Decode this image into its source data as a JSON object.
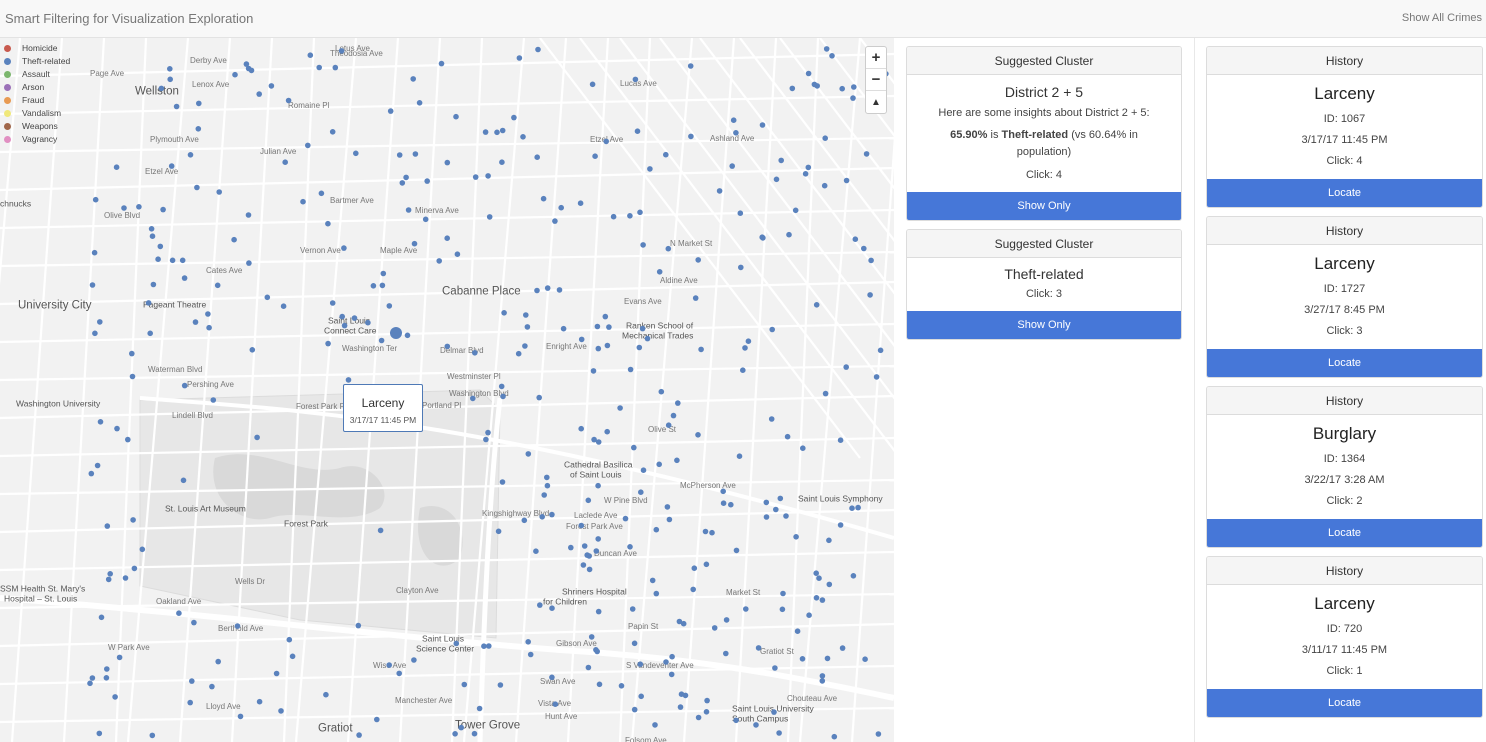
{
  "header": {
    "title": "Smart Filtering for Visualization Exploration",
    "show_all": "Show All Crimes"
  },
  "legend": [
    {
      "label": "Homicide",
      "color": "#c85a4e"
    },
    {
      "label": "Theft-related",
      "color": "#5a82bd"
    },
    {
      "label": "Assault",
      "color": "#7cb66e"
    },
    {
      "label": "Arson",
      "color": "#9b70b8"
    },
    {
      "label": "Fraud",
      "color": "#e89a52"
    },
    {
      "label": "Vandalism",
      "color": "#f0e87a"
    },
    {
      "label": "Weapons",
      "color": "#a0664a"
    },
    {
      "label": "Vagrancy",
      "color": "#e18fc2"
    }
  ],
  "zoom": {
    "in": "+",
    "out": "−",
    "reset": "▲"
  },
  "tooltip": {
    "title": "Larceny",
    "time": "3/17/17 11:45 PM"
  },
  "map_labels": {
    "neighborhoods": [
      {
        "text": "Wellston"
      },
      {
        "text": "University City"
      },
      {
        "text": "Cabanne Place"
      },
      {
        "text": "Gratiot"
      },
      {
        "text": "Tower Grove"
      }
    ],
    "streets": [
      {
        "text": "Derby Ave"
      },
      {
        "text": "Lotus Ave"
      },
      {
        "text": "Page Ave"
      },
      {
        "text": "Lenox Ave"
      },
      {
        "text": "Plymouth Ave"
      },
      {
        "text": "Etzel Ave"
      },
      {
        "text": "Olive Blvd"
      },
      {
        "text": "Vernon Ave"
      },
      {
        "text": "Cates Ave"
      },
      {
        "text": "Maple Ave"
      },
      {
        "text": "Washington Ter"
      },
      {
        "text": "Delmar Blvd"
      },
      {
        "text": "Waterman Blvd"
      },
      {
        "text": "Pershing Ave"
      },
      {
        "text": "Lindell Blvd"
      },
      {
        "text": "Forest Park Pkwy"
      },
      {
        "text": "Enright Ave"
      },
      {
        "text": "Evans Ave"
      },
      {
        "text": "Aldine Ave"
      },
      {
        "text": "N Market St"
      },
      {
        "text": "Lucas Ave"
      },
      {
        "text": "Olive St"
      },
      {
        "text": "W Pine Blvd"
      },
      {
        "text": "Laclede Ave"
      },
      {
        "text": "Forest Park Ave"
      },
      {
        "text": "Duncan Ave"
      },
      {
        "text": "Clayton Ave"
      },
      {
        "text": "Oakland Ave"
      },
      {
        "text": "Berthold Ave"
      },
      {
        "text": "W Park Ave"
      },
      {
        "text": "Wise Ave"
      },
      {
        "text": "Manchester Ave"
      },
      {
        "text": "Market St"
      },
      {
        "text": "Papin St"
      },
      {
        "text": "Chouteau Ave"
      },
      {
        "text": "Gratiot St"
      },
      {
        "text": "Kingshighway Blvd"
      },
      {
        "text": "S Vandeventer Ave"
      },
      {
        "text": "Folsom Ave"
      },
      {
        "text": "Lloyd Ave"
      },
      {
        "text": "McPherson Ave"
      },
      {
        "text": "Ashland Ave"
      },
      {
        "text": "Etzel Ave"
      },
      {
        "text": "Bartmer Ave"
      },
      {
        "text": "Minerva Ave"
      },
      {
        "text": "Theodosia Ave"
      },
      {
        "text": "Romaine Pl"
      },
      {
        "text": "Julian Ave"
      },
      {
        "text": "Gibson Ave"
      },
      {
        "text": "Swan Ave"
      },
      {
        "text": "Vista Ave"
      },
      {
        "text": "Hunt Ave"
      },
      {
        "text": "Wells Dr"
      },
      {
        "text": "Portland Pl"
      },
      {
        "text": "Westminster Pl"
      },
      {
        "text": "Washington Blvd"
      }
    ],
    "places": [
      {
        "text": "Saint Louis"
      },
      {
        "text": "Connect Care"
      },
      {
        "text": "Pageant Theatre"
      },
      {
        "text": "Washington University"
      },
      {
        "text": "St. Louis Art Museum"
      },
      {
        "text": "Forest Park"
      },
      {
        "text": "Cathedral Basilica"
      },
      {
        "text": "of Saint Louis"
      },
      {
        "text": "Ranken School of"
      },
      {
        "text": "Mechanical Trades"
      },
      {
        "text": "Shriners Hospital"
      },
      {
        "text": "for Children"
      },
      {
        "text": "Saint Louis"
      },
      {
        "text": "Science Center"
      },
      {
        "text": "SSM Health St. Mary's"
      },
      {
        "text": "Hospital – St. Louis"
      },
      {
        "text": "Saint Louis Symphony"
      },
      {
        "text": "Saint Louis University"
      },
      {
        "text": "South Campus"
      },
      {
        "text": "chnucks"
      }
    ]
  },
  "clusters": [
    {
      "header": "Suggested Cluster",
      "title": "District 2 + 5",
      "intro": "Here are some insights about District 2 + 5:",
      "percent": "65.90%",
      "mid": " is ",
      "category": "Theft-related",
      "rest": " (vs 60.64% in population)",
      "click": "Click: 4",
      "button": "Show Only"
    },
    {
      "header": "Suggested Cluster",
      "title": "Theft-related",
      "click": "Click: 3",
      "button": "Show Only"
    }
  ],
  "history": [
    {
      "header": "History",
      "title": "Larceny",
      "id": "ID: 1067",
      "time": "3/17/17 11:45 PM",
      "click": "Click: 4",
      "button": "Locate"
    },
    {
      "header": "History",
      "title": "Larceny",
      "id": "ID: 1727",
      "time": "3/27/17 8:45 PM",
      "click": "Click: 3",
      "button": "Locate"
    },
    {
      "header": "History",
      "title": "Burglary",
      "id": "ID: 1364",
      "time": "3/22/17 3:28 AM",
      "click": "Click: 2",
      "button": "Locate"
    },
    {
      "header": "History",
      "title": "Larceny",
      "id": "ID: 720",
      "time": "3/11/17 11:45 PM",
      "click": "Click: 1",
      "button": "Locate"
    }
  ]
}
